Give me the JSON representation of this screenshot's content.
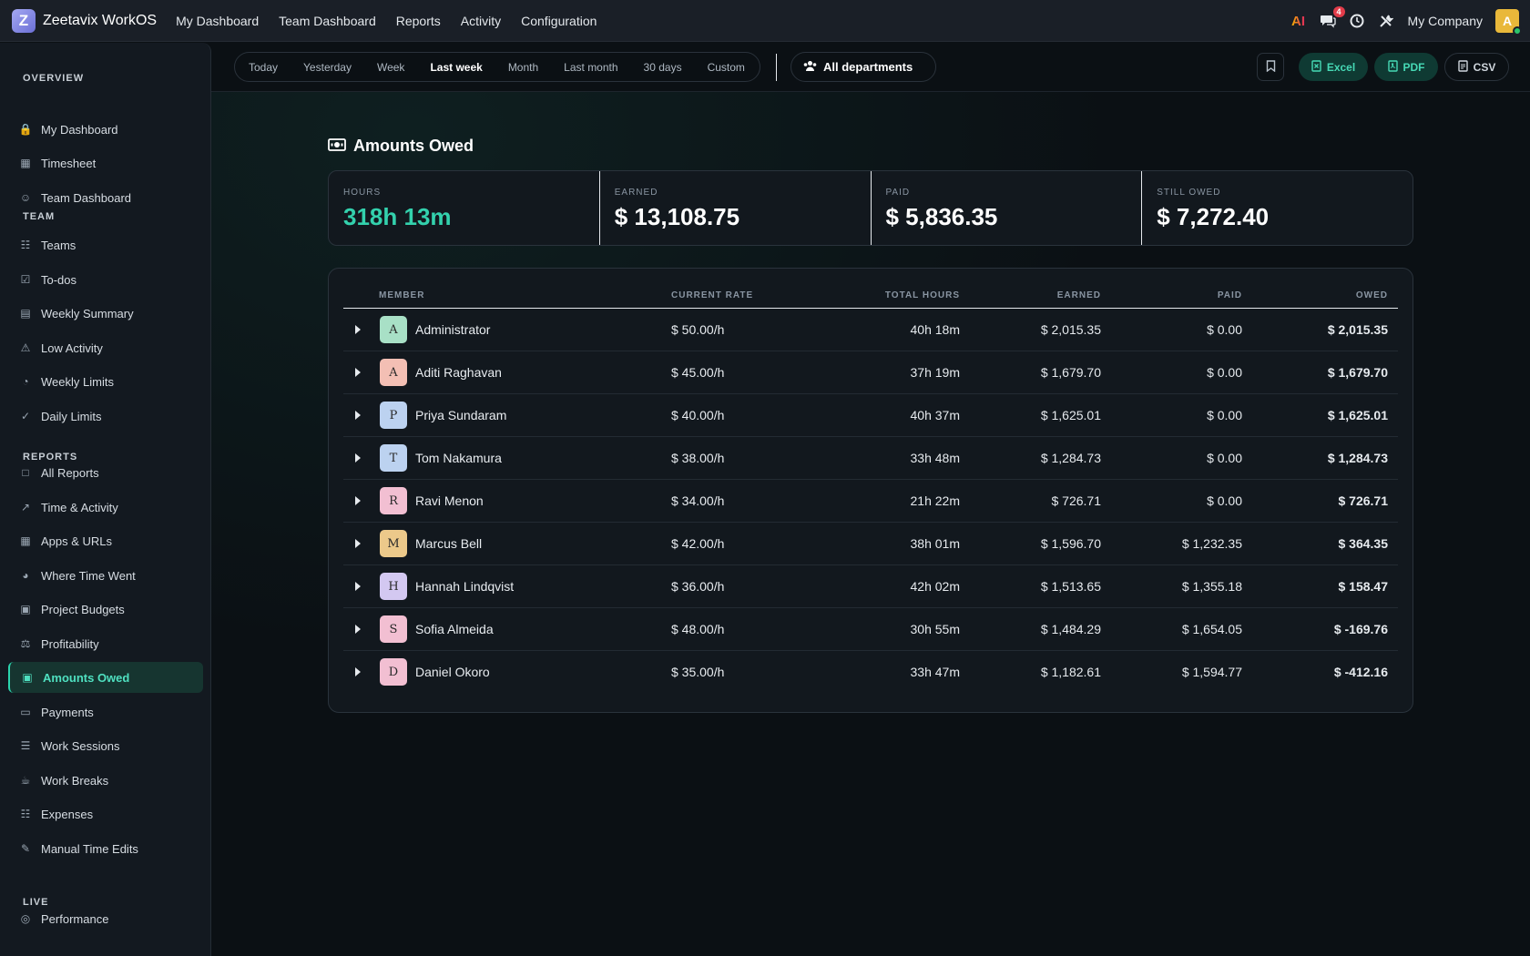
{
  "app": {
    "logo_letter": "Z",
    "name": "Zeetavix WorkOS"
  },
  "top_nav": [
    "My Dashboard",
    "Team Dashboard",
    "Reports",
    "Activity",
    "Configuration"
  ],
  "top_right": {
    "ai_label": "AI",
    "notif_count": "4",
    "company": "My Company",
    "avatar_letter": "A"
  },
  "sidebar": {
    "overview_title": "OVERVIEW",
    "team_title": "TEAM",
    "reports_title": "REPORTS",
    "live_title": "LIVE",
    "items": [
      {
        "label": "My Dashboard",
        "icon": "lock-icon"
      },
      {
        "label": "Timesheet",
        "icon": "calendar-icon"
      },
      {
        "label": "Team Dashboard",
        "icon": "users-icon"
      },
      {
        "label": "Teams",
        "icon": "sitemap-icon"
      },
      {
        "label": "To-dos",
        "icon": "checkbox-icon"
      },
      {
        "label": "Weekly Summary",
        "icon": "table-icon"
      },
      {
        "label": "Low Activity",
        "icon": "warning-icon"
      },
      {
        "label": "Weekly Limits",
        "icon": "gauge-icon"
      },
      {
        "label": "Daily Limits",
        "icon": "calendar-check-icon"
      },
      {
        "label": "All Reports",
        "icon": "folder-icon"
      },
      {
        "label": "Time & Activity",
        "icon": "line-chart-icon"
      },
      {
        "label": "Apps & URLs",
        "icon": "grid-icon"
      },
      {
        "label": "Where Time Went",
        "icon": "pie-chart-icon"
      },
      {
        "label": "Project Budgets",
        "icon": "briefcase-icon"
      },
      {
        "label": "Profitability",
        "icon": "scale-icon"
      },
      {
        "label": "Amounts Owed",
        "icon": "money-icon"
      },
      {
        "label": "Payments",
        "icon": "credit-card-icon"
      },
      {
        "label": "Work Sessions",
        "icon": "list-icon"
      },
      {
        "label": "Work Breaks",
        "icon": "coffee-icon"
      },
      {
        "label": "Expenses",
        "icon": "receipt-icon"
      },
      {
        "label": "Manual Time Edits",
        "icon": "edit-icon"
      },
      {
        "label": "Performance",
        "icon": "target-icon"
      }
    ]
  },
  "toolbar": {
    "ranges": [
      "Today",
      "Yesterday",
      "Week",
      "Last week",
      "Month",
      "Last month",
      "30 days",
      "Custom"
    ],
    "active_range": "Last week",
    "department": "All departments",
    "excel": "Excel",
    "pdf": "PDF",
    "csv": "CSV"
  },
  "page": {
    "title": "Amounts Owed",
    "stats": [
      {
        "label": "HOURS",
        "value": "318h 13m"
      },
      {
        "label": "EARNED",
        "value": "$ 13,108.75"
      },
      {
        "label": "PAID",
        "value": "$ 5,836.35"
      },
      {
        "label": "STILL OWED",
        "value": "$ 7,272.40"
      }
    ]
  },
  "table": {
    "headers": {
      "member": "MEMBER",
      "rate": "CURRENT RATE",
      "hours": "TOTAL HOURS",
      "earned": "EARNED",
      "paid": "PAID",
      "owed": "OWED"
    },
    "rows": [
      {
        "initial": "A",
        "name": "Administrator",
        "rate": "$ 50.00/h",
        "hours": "40h 18m",
        "earned": "$ 2,015.35",
        "paid": "$ 0.00",
        "owed": "$ 2,015.35",
        "color": "#a8e0c6"
      },
      {
        "initial": "A",
        "name": "Aditi Raghavan",
        "rate": "$ 45.00/h",
        "hours": "37h 19m",
        "earned": "$ 1,679.70",
        "paid": "$ 0.00",
        "owed": "$ 1,679.70",
        "color": "#f3bfb4"
      },
      {
        "initial": "P",
        "name": "Priya Sundaram",
        "rate": "$ 40.00/h",
        "hours": "40h 37m",
        "earned": "$ 1,625.01",
        "paid": "$ 0.00",
        "owed": "$ 1,625.01",
        "color": "#bcd2f0"
      },
      {
        "initial": "T",
        "name": "Tom Nakamura",
        "rate": "$ 38.00/h",
        "hours": "33h 48m",
        "earned": "$ 1,284.73",
        "paid": "$ 0.00",
        "owed": "$ 1,284.73",
        "color": "#bcd2f0"
      },
      {
        "initial": "R",
        "name": "Ravi Menon",
        "rate": "$ 34.00/h",
        "hours": "21h 22m",
        "earned": "$ 726.71",
        "paid": "$ 0.00",
        "owed": "$ 726.71",
        "color": "#f2bfd2"
      },
      {
        "initial": "M",
        "name": "Marcus Bell",
        "rate": "$ 42.00/h",
        "hours": "38h 01m",
        "earned": "$ 1,596.70",
        "paid": "$ 1,232.35",
        "owed": "$ 364.35",
        "color": "#ecc98a"
      },
      {
        "initial": "H",
        "name": "Hannah Lindqvist",
        "rate": "$ 36.00/h",
        "hours": "42h 02m",
        "earned": "$ 1,513.65",
        "paid": "$ 1,355.18",
        "owed": "$ 158.47",
        "color": "#d3c8f1"
      },
      {
        "initial": "S",
        "name": "Sofia Almeida",
        "rate": "$ 48.00/h",
        "hours": "30h 55m",
        "earned": "$ 1,484.29",
        "paid": "$ 1,654.05",
        "owed": "$ -169.76",
        "color": "#f2bfd2"
      },
      {
        "initial": "D",
        "name": "Daniel Okoro",
        "rate": "$ 35.00/h",
        "hours": "33h 47m",
        "earned": "$ 1,182.61",
        "paid": "$ 1,594.77",
        "owed": "$ -412.16",
        "color": "#f2bfd2"
      }
    ]
  },
  "colors": {
    "accent": "#33d1ad",
    "active_bg": "#163530",
    "bg": "#0b1014"
  }
}
